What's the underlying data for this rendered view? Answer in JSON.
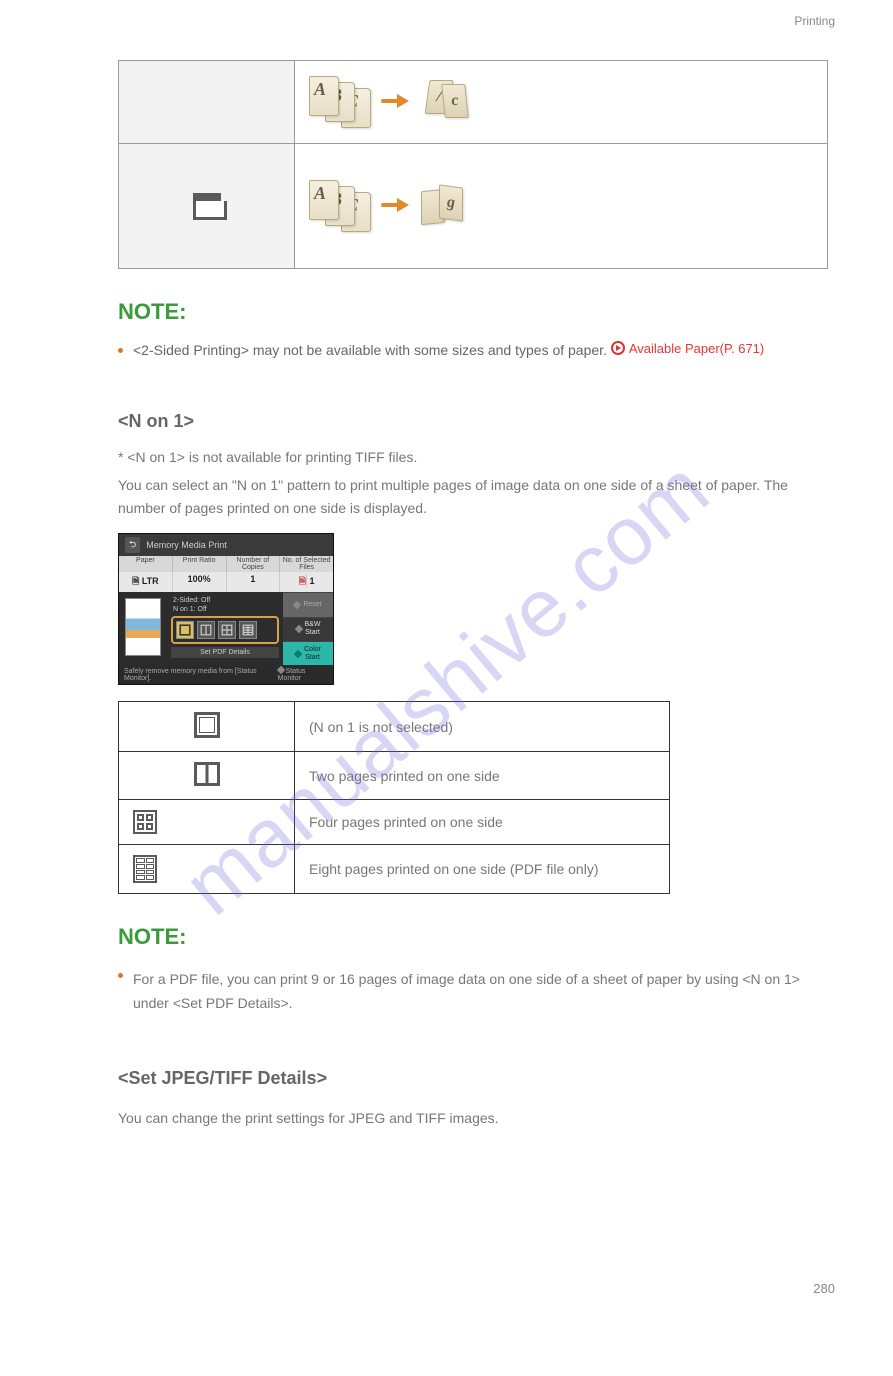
{
  "header_label": "Printing",
  "table1": {
    "row1_illustration_alt": "A B C sheets to top-bound booklet",
    "row2_icon_alt": "calendar-type-icon",
    "row2_illustration_alt": "A B C sheets to side-bound booklet"
  },
  "note1": {
    "heading": "NOTE:",
    "bullet_text": "<2-Sided Printing> may not be available with some sizes and types of paper. ",
    "link_text": "Available Paper(P. 671)"
  },
  "section_n_on_1": {
    "heading": "<N on 1>",
    "sub": "* <N on 1> is not available for printing TIFF files.",
    "desc": "You can select an \"N on 1\" pattern to print multiple pages of image data on one side of a sheet of paper. The number of pages printed on one side is displayed."
  },
  "device": {
    "title": "Memory Media Print",
    "cols": [
      "Paper",
      "Print Ratio",
      "Number of Copies",
      "No. of Selected Files"
    ],
    "vals_paper": "LTR",
    "vals_ratio": "100%",
    "vals_copies": "1",
    "vals_files": "1",
    "mid_top": "2-Sided: Off",
    "mid_label": "N on 1: Off",
    "set_pdf": "Set PDF Details",
    "btn_reset": "Reset",
    "btn_bw": "B&W\nStart",
    "btn_color": "Color\nStart",
    "footer_text": "Safely remove memory media from [Status Monitor].",
    "footer_btn": "Status Monitor"
  },
  "table2": {
    "r1": "(N on 1 is not selected)",
    "r2": "Two pages printed on one side",
    "r3": "Four pages printed on one side",
    "r4": "Eight pages printed on one side (PDF file only)"
  },
  "note2": {
    "heading": "NOTE:",
    "text": "For a PDF file, you can print 9 or 16 pages of image data on one side of a sheet of paper by using <N on 1> under <Set PDF Details>."
  },
  "section_jpeg": "<Set JPEG/TIFF Details>",
  "jpeg_desc": "You can change the print settings for JPEG and TIFF images.",
  "page_number": "280"
}
